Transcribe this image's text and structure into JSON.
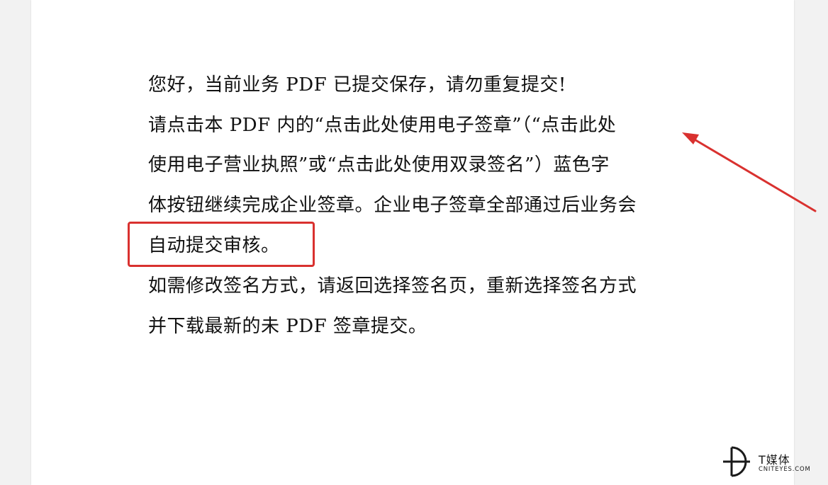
{
  "document": {
    "lines": [
      "您好，当前业务 PDF 已提交保存，请勿重复提交!",
      "请点击本 PDF 内的“点击此处使用电子签章”（“点击此处",
      "使用电子营业执照”或“点击此处使用双录签名”）蓝色字",
      "体按钮继续完成企业签章。企业电子签章全部通过后业务会",
      "自动提交审核。",
      "如需修改签名方式，请返回选择签名页，重新选择签名方式",
      "并下载最新的未 PDF 签章提交。"
    ]
  },
  "annotations": {
    "box_color": "#d9312f",
    "arrow_color": "#d9312f"
  },
  "watermark": {
    "title": "T媒体",
    "subtitle": "CNITEYES.COM"
  }
}
